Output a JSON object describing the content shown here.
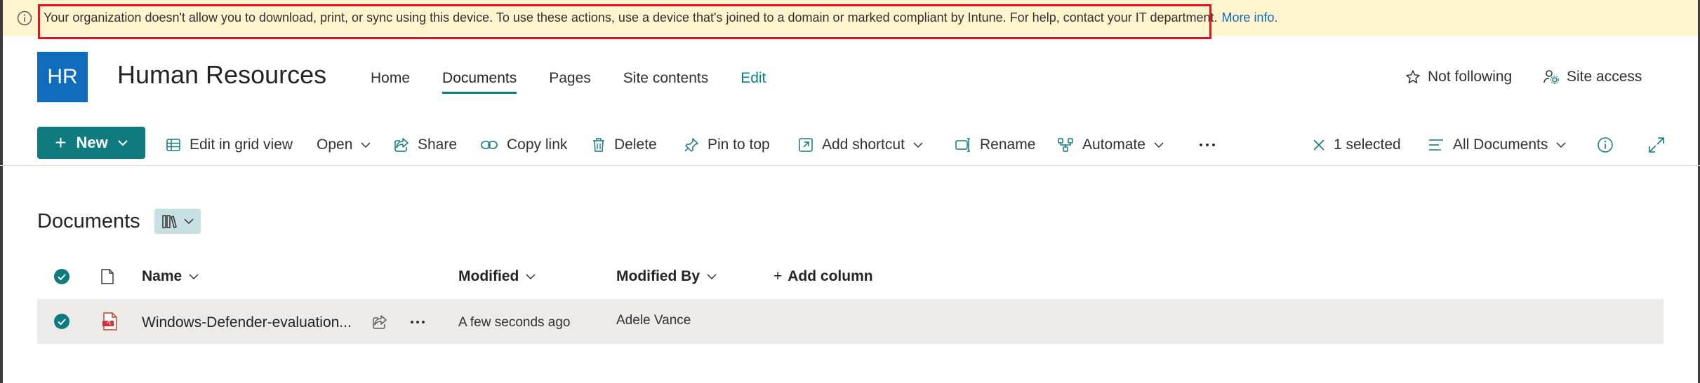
{
  "banner": {
    "message": "Your organization doesn't allow you to download, print, or sync using this device. To use these actions, use a device that's joined to a domain or marked compliant by Intune. For help, contact your IT department.",
    "more_info": "More info."
  },
  "site": {
    "logo_text": "HR",
    "title": "Human Resources",
    "nav": [
      "Home",
      "Documents",
      "Pages",
      "Site contents",
      "Edit"
    ],
    "follow_label": "Not following",
    "access_label": "Site access"
  },
  "commandbar": {
    "new_label": "New",
    "edit_grid": "Edit in grid view",
    "open": "Open",
    "share": "Share",
    "copy_link": "Copy link",
    "delete": "Delete",
    "pin": "Pin to top",
    "add_shortcut": "Add shortcut",
    "rename": "Rename",
    "automate": "Automate",
    "selected": "1 selected",
    "view": "All Documents"
  },
  "library": {
    "title": "Documents",
    "columns": {
      "name": "Name",
      "modified": "Modified",
      "modified_by": "Modified By",
      "add_column": "Add column"
    },
    "rows": [
      {
        "name": "Windows-Defender-evaluation...",
        "modified": "A few seconds ago",
        "modified_by": "Adele Vance"
      }
    ]
  },
  "colors": {
    "accent": "#0f7b7f",
    "banner_bg": "#fff4ce",
    "link": "#0f6cbd",
    "highlight": "#e3131d"
  }
}
